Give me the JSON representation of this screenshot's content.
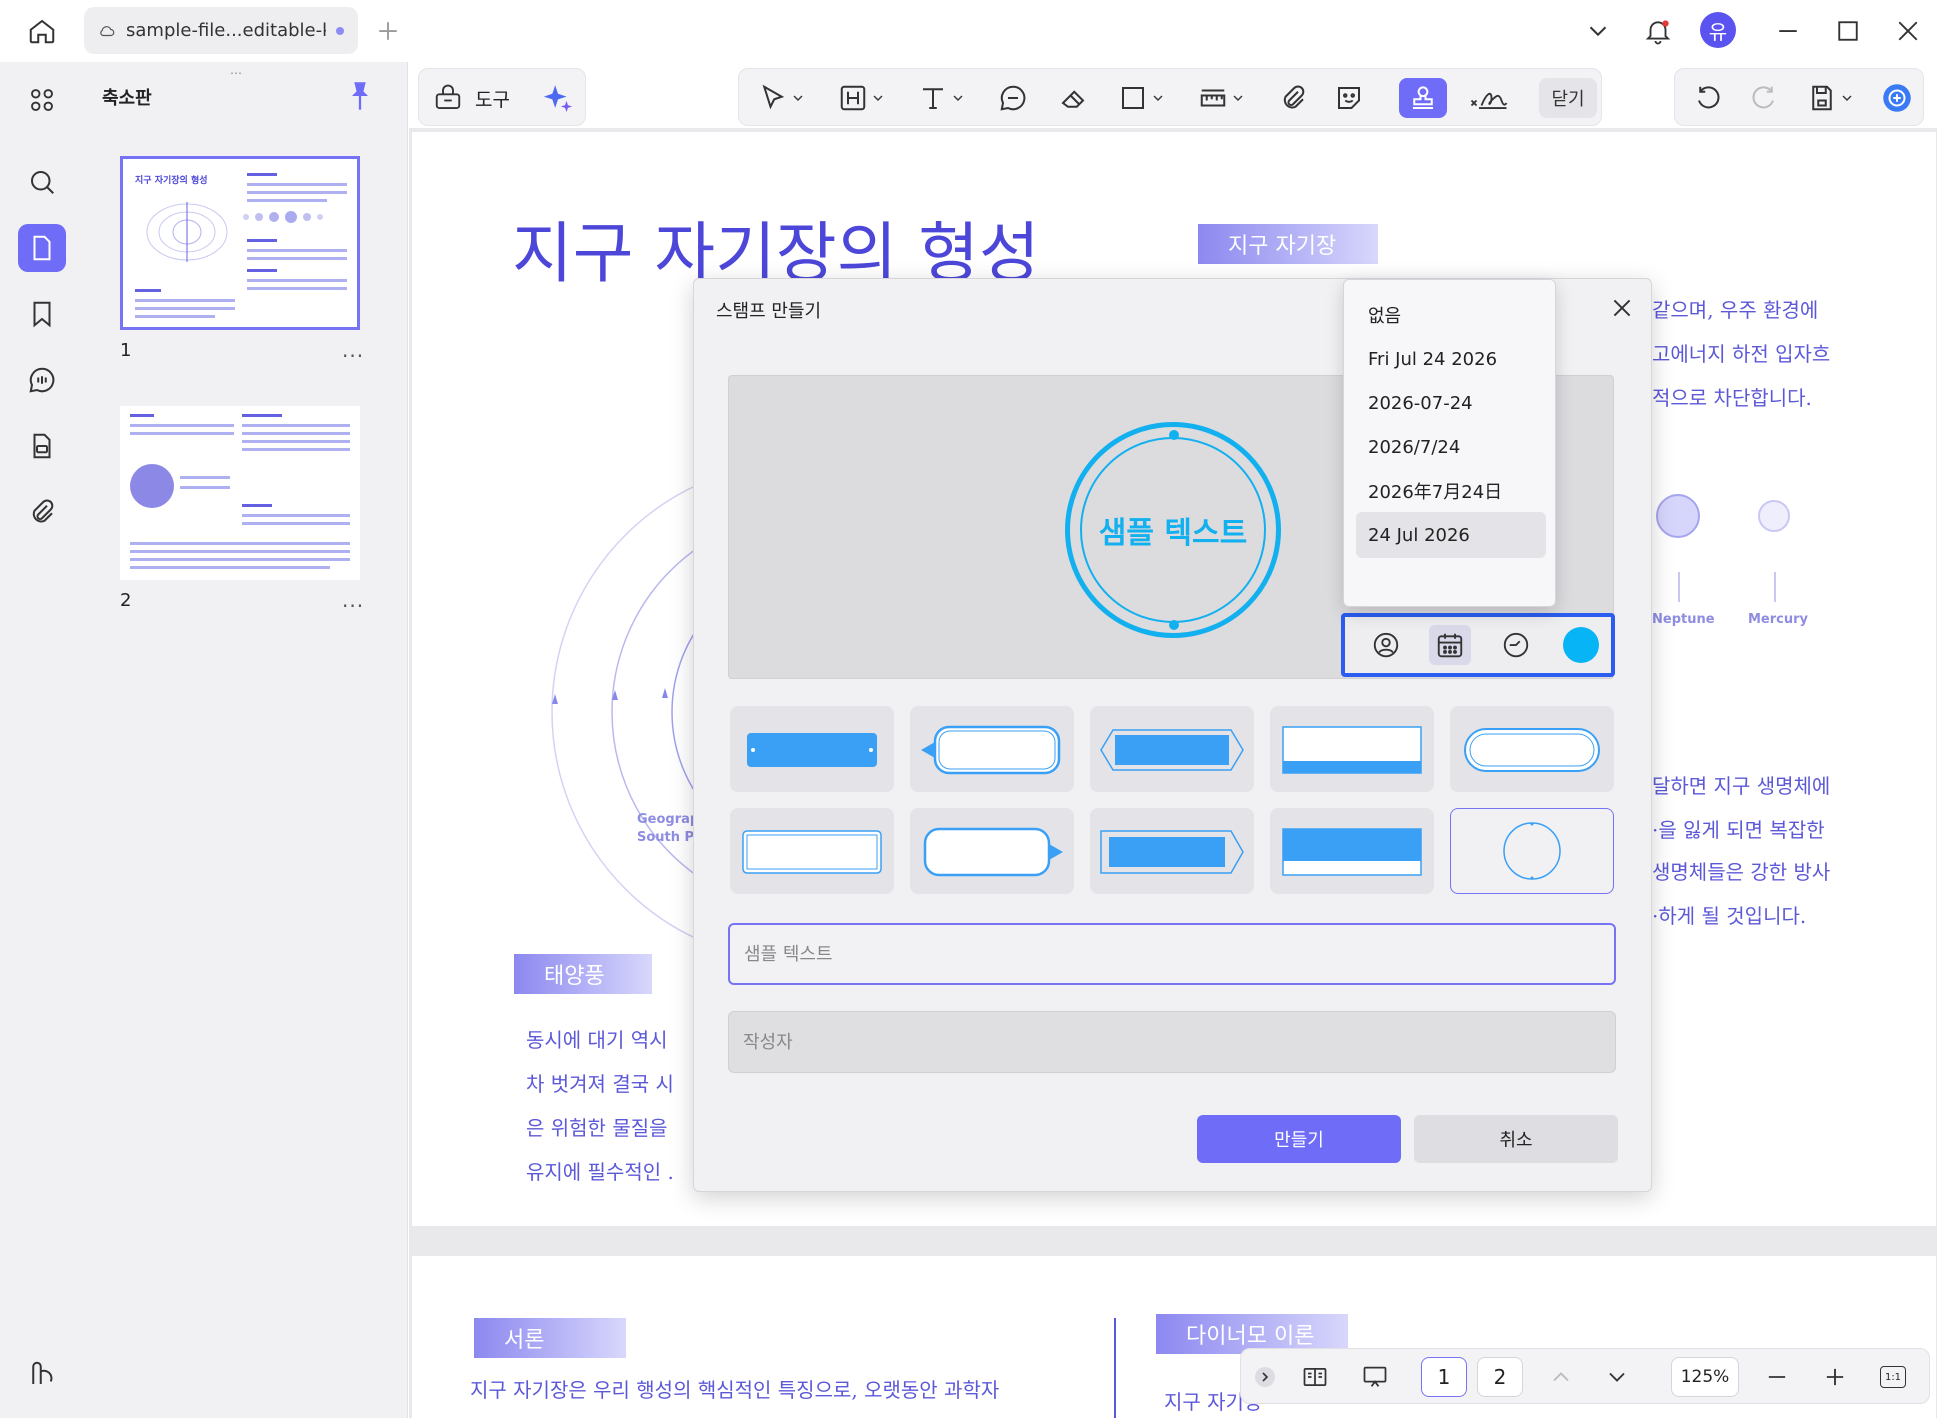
{
  "window": {
    "tab_title": "sample-file...editable-kr",
    "user_initial": "유"
  },
  "sidebar": {
    "panel_title": "축소판",
    "thumbnails": [
      {
        "page": "1",
        "title": "지구 자기장의 형성"
      },
      {
        "page": "2"
      }
    ],
    "more": "..."
  },
  "toolbar": {
    "tools_label": "도구",
    "close_label": "닫기"
  },
  "document": {
    "title": "지구 자기장의 형성",
    "tag_magnetic": "지구 자기장",
    "tag_solar_wind": "태양풍",
    "right_text": [
      "같으며, 우주 환경에",
      "고에너지 하전 입자흐",
      "적으로 차단합니다."
    ],
    "right_text2": [
      "달하면 지구 생명체에",
      "·을 잃게 되면 복잡한",
      "생명체들은 강한 방사",
      "·하게 될 것입니다."
    ],
    "left_text": [
      "동시에 대기 역시",
      "차 벗겨져 결국 시",
      "은 위험한 물질을",
      "유지에 필수적인 ."
    ],
    "planet_neptune": "Neptune",
    "planet_mercury": "Mercury",
    "geo_label": [
      "Geograp",
      "South Po"
    ],
    "page2_tag_intro": "서론",
    "page2_tag_dynamo": "다이너모 이론",
    "page2_text": "지구 자기장은 우리 행성의 핵심적인 특징으로, 오랫동안 과학자",
    "page2_text_right": "지구 자기장"
  },
  "modal": {
    "title": "스탬프 만들기",
    "stamp_text": "샘플 텍스트",
    "stamp_color": "#07b4f5",
    "text_placeholder": "샘플 텍스트",
    "author_placeholder": "작성자",
    "create_label": "만들기",
    "cancel_label": "취소"
  },
  "date_menu": {
    "items": [
      "없음",
      "Fri Jul 24 2026",
      "2026-07-24",
      "2026/7/24",
      "2026年7月24日",
      "24 Jul 2026"
    ],
    "selected": "24 Jul 2026"
  },
  "bottom_nav": {
    "page1": "1",
    "page2": "2",
    "zoom": "125%",
    "fit": "1:1"
  },
  "colors": {
    "accent": "#6f6cf7",
    "stamp_blue": "#13b0ef",
    "doc_text": "#5c59d8"
  }
}
